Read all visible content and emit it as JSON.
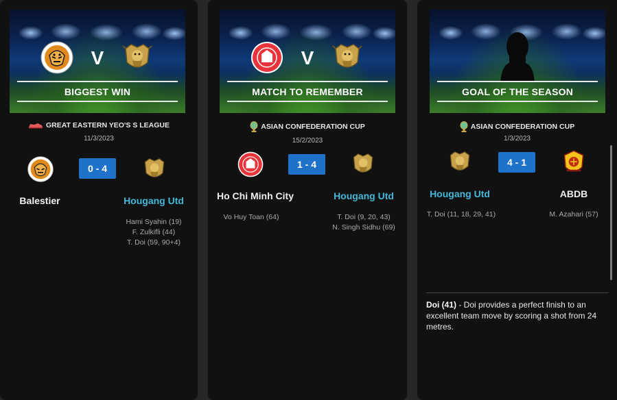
{
  "cards": [
    {
      "banner_title": "BIGGEST WIN",
      "banner_v": "V",
      "competition": "GREAT EASTERN YEO'S S LEAGUE",
      "competition_icon": "league-shoe-icon",
      "date": "11/3/2023",
      "score": "0 - 4",
      "home_team": "Balestier",
      "away_team": "Hougang Utd",
      "home_scorers": [],
      "away_scorers": [
        "Hami Syahin (19)",
        "F. Zulkifli (44)",
        "T. Doi (59, 90+4)"
      ]
    },
    {
      "banner_title": "MATCH TO REMEMBER",
      "banner_v": "V",
      "competition": "ASIAN CONFEDERATION CUP",
      "competition_icon": "trophy-icon",
      "date": "15/2/2023",
      "score": "1 - 4",
      "home_team": "Ho Chi Minh City",
      "away_team": "Hougang Utd",
      "home_scorers": [
        "Vo Huy Toan (64)"
      ],
      "away_scorers": [
        "T. Doi (9, 20, 43)",
        "N. Singh Sidhu (69)"
      ]
    },
    {
      "banner_title": "GOAL OF THE SEASON",
      "competition": "ASIAN CONFEDERATION CUP",
      "competition_icon": "trophy-icon",
      "date": "1/3/2023",
      "score": "4 - 1",
      "home_team": "Hougang Utd",
      "away_team": "ABDB",
      "home_scorers": [
        "T. Doi (11, 18, 29, 41)"
      ],
      "away_scorers": [
        "M. Azahari (57)"
      ],
      "goal_scorer": "Doi (41)",
      "goal_description": " - Doi provides a perfect finish to an excellent team move by scoring a shot from 24 metres."
    }
  ],
  "colors": {
    "score_bg": "#1f72c9",
    "highlight_team": "#45b7d8",
    "card_bg": "#111111",
    "page_bg": "#262626"
  }
}
